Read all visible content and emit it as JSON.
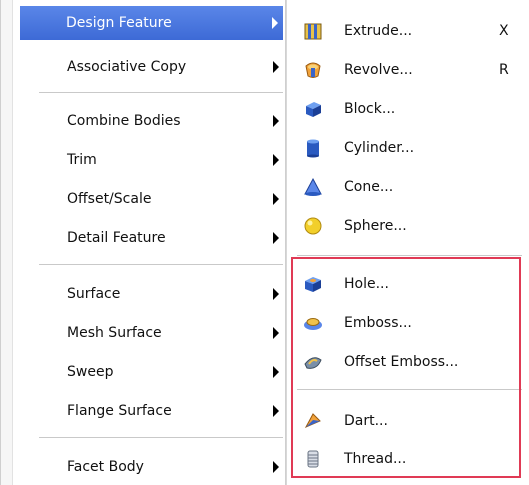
{
  "main_menu": {
    "items": [
      {
        "label": "Design Feature",
        "highlighted": true
      },
      {
        "label": "Associative Copy"
      },
      {
        "label": "Combine Bodies"
      },
      {
        "label": "Trim"
      },
      {
        "label": "Offset/Scale"
      },
      {
        "label": "Detail Feature"
      },
      {
        "label": "Surface"
      },
      {
        "label": "Mesh Surface"
      },
      {
        "label": "Sweep"
      },
      {
        "label": "Flange Surface"
      },
      {
        "label": "Facet Body"
      }
    ]
  },
  "submenu": {
    "items": [
      {
        "label": "Extrude...",
        "shortcut": "X",
        "icon": "extrude-icon"
      },
      {
        "label": "Revolve...",
        "shortcut": "R",
        "icon": "revolve-icon"
      },
      {
        "label": "Block...",
        "icon": "block-icon"
      },
      {
        "label": "Cylinder...",
        "icon": "cylinder-icon"
      },
      {
        "label": "Cone...",
        "icon": "cone-icon"
      },
      {
        "label": "Sphere...",
        "icon": "sphere-icon"
      },
      {
        "label": "Hole...",
        "icon": "hole-icon"
      },
      {
        "label": "Emboss...",
        "icon": "emboss-icon"
      },
      {
        "label": "Offset Emboss...",
        "icon": "offset-emboss-icon"
      },
      {
        "label": "Dart...",
        "icon": "dart-icon"
      },
      {
        "label": "Thread...",
        "icon": "thread-icon"
      }
    ]
  },
  "colors": {
    "highlight": "#4a78e0",
    "annotation_box": "#e03a55"
  }
}
